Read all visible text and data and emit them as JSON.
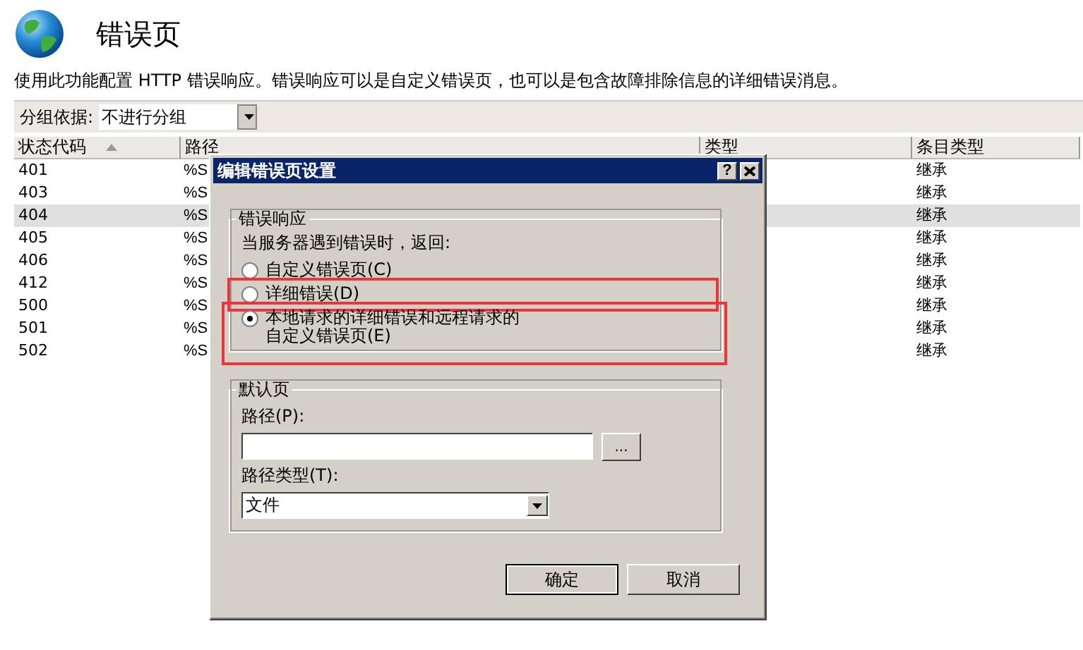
{
  "header": {
    "title": "错误页",
    "description": "使用此功能配置 HTTP 错误响应。错误响应可以是自定义错误页，也可以是包含故障排除信息的详细错误消息。"
  },
  "group_by": {
    "label": "分组依据:",
    "value": "不进行分组"
  },
  "table": {
    "columns": [
      {
        "label": "状态代码",
        "sorted": true
      },
      {
        "label": "路径",
        "sorted": false
      },
      {
        "label": "类型",
        "sorted": false
      },
      {
        "label": "条目类型",
        "sorted": false
      }
    ],
    "rows": [
      {
        "status_code": "401",
        "path": "%S",
        "entry_type": "继承",
        "selected": false
      },
      {
        "status_code": "403",
        "path": "%S",
        "entry_type": "继承",
        "selected": false
      },
      {
        "status_code": "404",
        "path": "%S",
        "entry_type": "继承",
        "selected": true
      },
      {
        "status_code": "405",
        "path": "%S",
        "entry_type": "继承",
        "selected": false
      },
      {
        "status_code": "406",
        "path": "%S",
        "entry_type": "继承",
        "selected": false
      },
      {
        "status_code": "412",
        "path": "%S",
        "entry_type": "继承",
        "selected": false
      },
      {
        "status_code": "500",
        "path": "%S",
        "entry_type": "继承",
        "selected": false
      },
      {
        "status_code": "501",
        "path": "%S",
        "entry_type": "继承",
        "selected": false
      },
      {
        "status_code": "502",
        "path": "%S",
        "entry_type": "继承",
        "selected": false
      }
    ]
  },
  "dialog": {
    "title": "编辑错误页设置",
    "help": "?",
    "error_response": {
      "legend": "错误响应",
      "prompt": "当服务器遇到错误时，返回:",
      "options": [
        {
          "label": "自定义错误页(C)",
          "selected": false,
          "highlighted": false
        },
        {
          "label": "详细错误(D)",
          "selected": false,
          "highlighted": true
        },
        {
          "label": "本地请求的详细错误和远程请求的自定义错误页(E)",
          "selected": true,
          "highlighted": true
        }
      ]
    },
    "default_page": {
      "legend": "默认页",
      "path_label": "路径(P):",
      "browse": "...",
      "path_type_label": "路径类型(T):",
      "path_type": "文件"
    },
    "buttons": [
      "确定",
      "取消"
    ]
  }
}
